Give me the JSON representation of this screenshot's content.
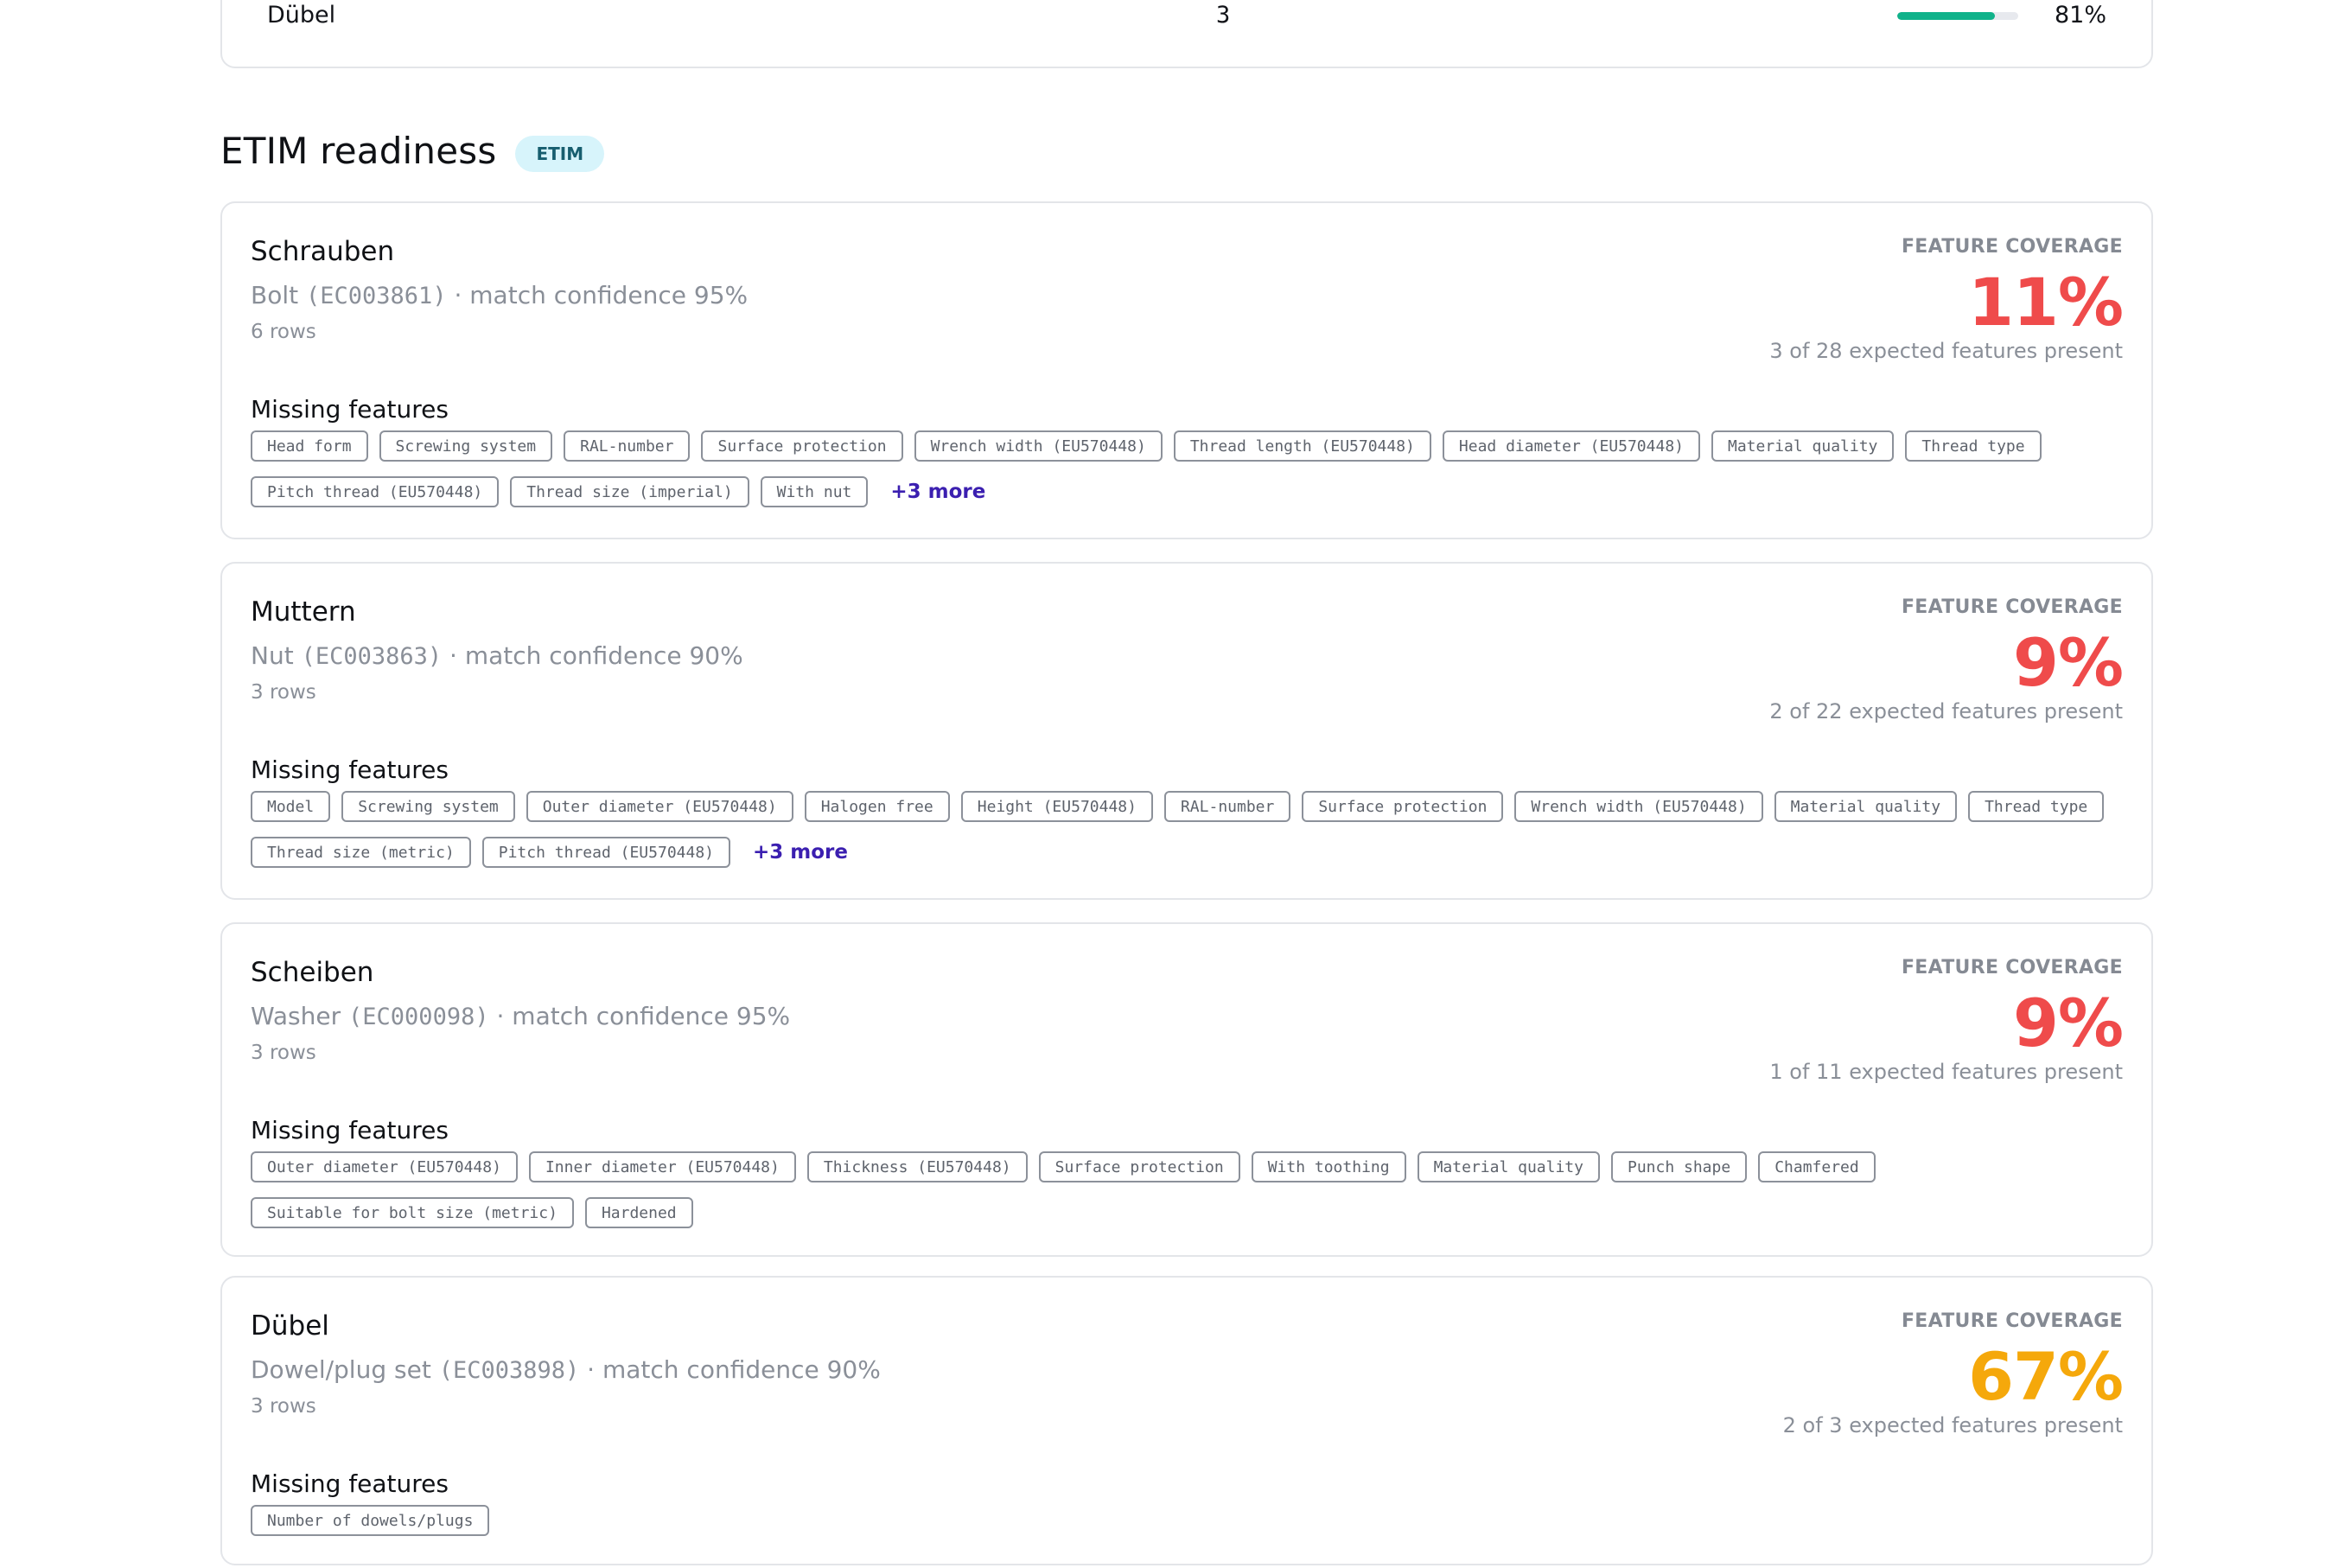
{
  "top_row": {
    "name": "Dübel",
    "count": "3",
    "progress_percent": 81,
    "percent_label": "81%",
    "bar_color": "#10b28a"
  },
  "etim": {
    "title": "ETIM readiness",
    "badge": "ETIM",
    "cards": [
      {
        "group": "Schrauben",
        "class_name": "Bolt",
        "class_code": "(EC003861)",
        "confidence": "· match confidence 95%",
        "rows": "6 rows",
        "coverage_label": "FEATURE COVERAGE",
        "coverage": "11%",
        "coverage_color": "#ef4b4b",
        "coverage_sub": "3 of 28 expected features present",
        "missing_title": "Missing features",
        "missing": [
          "Head form",
          "Screwing system",
          "RAL-number",
          "Surface protection",
          "Wrench width (EU570448)",
          "Thread length (EU570448)",
          "Head diameter (EU570448)",
          "Material quality",
          "Thread type",
          "Pitch thread (EU570448)",
          "Thread size (imperial)",
          "With nut"
        ],
        "more": "+3 more"
      },
      {
        "group": "Muttern",
        "class_name": "Nut",
        "class_code": "(EC003863)",
        "confidence": "· match confidence 90%",
        "rows": "3 rows",
        "coverage_label": "FEATURE COVERAGE",
        "coverage": "9%",
        "coverage_color": "#ef4b4b",
        "coverage_sub": "2 of 22 expected features present",
        "missing_title": "Missing features",
        "missing": [
          "Model",
          "Screwing system",
          "Outer diameter (EU570448)",
          "Halogen free",
          "Height (EU570448)",
          "RAL-number",
          "Surface protection",
          "Wrench width (EU570448)",
          "Material quality",
          "Thread type",
          "Thread size (metric)",
          "Pitch thread (EU570448)"
        ],
        "more": "+3 more"
      },
      {
        "group": "Scheiben",
        "class_name": "Washer",
        "class_code": "(EC000098)",
        "confidence": "· match confidence 95%",
        "rows": "3 rows",
        "coverage_label": "FEATURE COVERAGE",
        "coverage": "9%",
        "coverage_color": "#ef4b4b",
        "coverage_sub": "1 of 11 expected features present",
        "missing_title": "Missing features",
        "missing": [
          "Outer diameter (EU570448)",
          "Inner diameter (EU570448)",
          "Thickness (EU570448)",
          "Surface protection",
          "With toothing",
          "Material quality",
          "Punch shape",
          "Chamfered",
          "Suitable for bolt size (metric)",
          "Hardened"
        ],
        "more": ""
      },
      {
        "group": "Dübel",
        "class_name": "Dowel/plug set",
        "class_code": "(EC003898)",
        "confidence": "· match confidence 90%",
        "rows": "3 rows",
        "coverage_label": "FEATURE COVERAGE",
        "coverage": "67%",
        "coverage_color": "#f5a80b",
        "coverage_sub": "2 of 3 expected features present",
        "missing_title": "Missing features",
        "missing": [
          "Number of dowels/plugs"
        ],
        "more": ""
      }
    ]
  }
}
